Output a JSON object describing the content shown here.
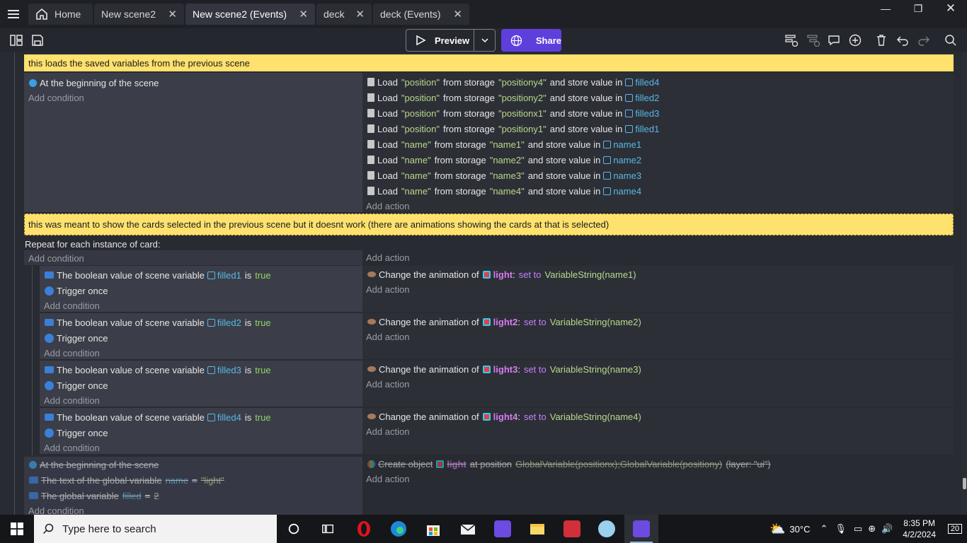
{
  "tabs": [
    {
      "label": "Home",
      "icon": "home-icon"
    },
    {
      "label": "New scene2"
    },
    {
      "label": "New scene2 (Events)",
      "active": true
    },
    {
      "label": "deck"
    },
    {
      "label": "deck (Events)"
    }
  ],
  "toolbar": {
    "preview_label": "Preview",
    "share_label": "Share"
  },
  "comments": {
    "c1": "this loads the saved variables from the previous scene",
    "c2": "this was meant to show the cards selected in the previous scene but it doesnt work (there are animations showing the cards at that is selected)"
  },
  "event1": {
    "condition": "At the beginning of the scene",
    "add_condition": "Add condition",
    "add_action": "Add action",
    "actions": [
      {
        "key": "position",
        "storage": "positiony4",
        "var": "filled4"
      },
      {
        "key": "position",
        "storage": "positiony2",
        "var": "filled2"
      },
      {
        "key": "position",
        "storage": "positionx1",
        "var": "filled3"
      },
      {
        "key": "position",
        "storage": "positiony1",
        "var": "filled1"
      },
      {
        "key": "name",
        "storage": "name1",
        "var": "name1"
      },
      {
        "key": "name",
        "storage": "name2",
        "var": "name2"
      },
      {
        "key": "name",
        "storage": "name3",
        "var": "name3"
      },
      {
        "key": "name",
        "storage": "name4",
        "var": "name4"
      }
    ],
    "words": {
      "load": "Load",
      "from": "from storage",
      "store": "and store value in"
    }
  },
  "repeat": {
    "header": "Repeat for each instance of card:",
    "add_condition": "Add condition",
    "add_action": "Add action",
    "words": {
      "bool": "The boolean value of scene variable",
      "is": "is",
      "true": "true",
      "trigger": "Trigger once",
      "change": "Change the animation of",
      "setto": "set to"
    },
    "subs": [
      {
        "var": "filled1",
        "obj": "light",
        "value": "VariableString(name1)"
      },
      {
        "var": "filled2",
        "obj": "light2",
        "value": "VariableString(name2)"
      },
      {
        "var": "filled3",
        "obj": "light3",
        "value": "VariableString(name3)"
      },
      {
        "var": "filled4",
        "obj": "light4",
        "value": "VariableString(name4)"
      }
    ]
  },
  "disabled_event": {
    "cond1": "At the beginning of the scene",
    "cond2_a": "The text of the global variable",
    "cond2_var": "name",
    "cond2_op": "=",
    "cond2_val": "\"light\"",
    "cond3_a": "The global variable",
    "cond3_var": "filled",
    "cond3_op": "=",
    "cond3_val": "2",
    "action_a": "Create object",
    "action_obj": "light",
    "action_b": "at position",
    "action_pos": "GlobalVariable(positionx);GlobalVariable(positiony)",
    "action_layer": "(layer: \"ui\")",
    "add_condition": "Add condition",
    "add_action": "Add action"
  },
  "taskbar": {
    "search_placeholder": "Type here to search",
    "temperature": "30°C",
    "time": "8:35 PM",
    "date": "4/2/2024",
    "notifications": "20"
  },
  "colors": {
    "accent": "#5f3fdc",
    "comment": "#ffe16e"
  }
}
